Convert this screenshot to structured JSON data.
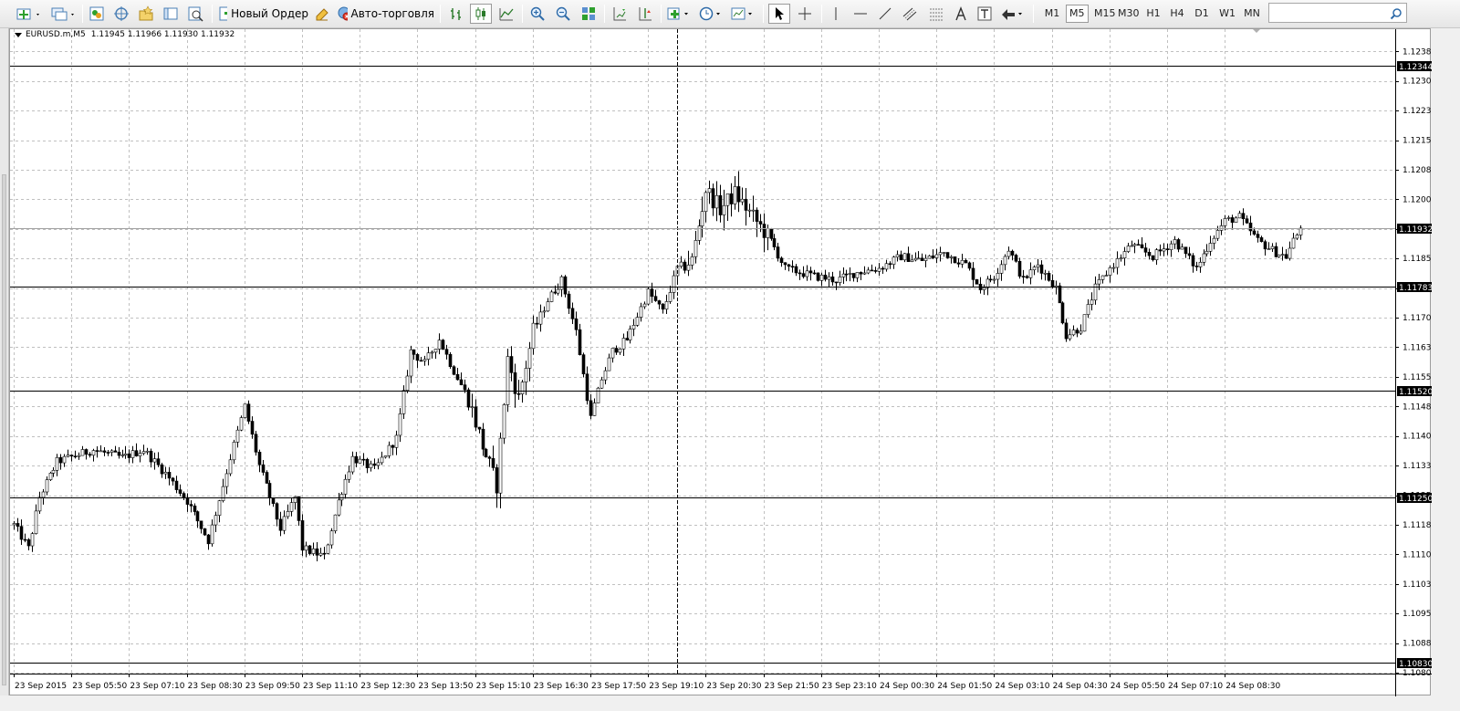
{
  "toolbar": {
    "new_order_label": "Новый Ордер",
    "autotrade_label": "Авто-торговля",
    "timeframes": [
      "M1",
      "M5",
      "M15",
      "M30",
      "H1",
      "H4",
      "D1",
      "W1",
      "MN"
    ],
    "active_timeframe": "M5",
    "search_value": "",
    "icons": [
      "new-chart-icon",
      "profiles-icon",
      "market-watch-icon",
      "navigator-icon",
      "data-window-icon",
      "terminal-icon",
      "strategy-tester-icon",
      "new-order-icon",
      "meta-editor-icon",
      "auto-trading-icon",
      "bar-chart-icon",
      "candlestick-icon",
      "line-chart-icon",
      "zoom-in-icon",
      "zoom-out-icon",
      "tile-windows-icon",
      "chart-shift-icon",
      "autoscroll-icon",
      "indicators-icon",
      "periods-icon",
      "templates-icon",
      "cursor-icon",
      "crosshair-icon",
      "vertical-line-icon",
      "horizontal-line-icon",
      "trendline-icon",
      "equidistant-channel-icon",
      "fibonacci-icon",
      "text-icon",
      "text-label-icon",
      "arrows-icon",
      "search-icon"
    ]
  },
  "chart": {
    "caption_symbol": "EURUSD.m,M5",
    "caption_ohlc": "1.11945 1.11966 1.11930 1.11932",
    "current_price": "1.11932",
    "current_price_value": 1.11932,
    "horizontal_lines": [
      {
        "value": 1.12344,
        "label": "1.12344"
      },
      {
        "value": 1.11783,
        "label": "1.11783"
      },
      {
        "value": 1.1152,
        "label": "1.11520"
      },
      {
        "value": 1.1125,
        "label": "1.11250"
      },
      {
        "value": 1.1083,
        "label": "1.10830"
      }
    ],
    "crosshair_time_index": 184,
    "colors": {
      "candle": "#000000",
      "grid": "#c0c0c0",
      "line": "#000000",
      "current_line": "#a0a0a0"
    }
  },
  "chart_data": {
    "type": "candlestick",
    "title": "EURUSD.m,M5",
    "ylim": [
      1.10805,
      1.1242
    ],
    "y_ticks": [
      "1.12380",
      "1.12305",
      "1.12230",
      "1.12155",
      "1.12080",
      "1.12005",
      "1.11930",
      "1.11855",
      "1.11780",
      "1.11705",
      "1.11630",
      "1.11555",
      "1.11480",
      "1.11405",
      "1.11330",
      "1.11255",
      "1.11180",
      "1.11105",
      "1.11030",
      "1.10955",
      "1.10880",
      "1.10805"
    ],
    "x_ticks": [
      "23 Sep 2015",
      "23 Sep 05:50",
      "23 Sep 07:10",
      "23 Sep 08:30",
      "23 Sep 09:50",
      "23 Sep 11:10",
      "23 Sep 12:30",
      "23 Sep 13:50",
      "23 Sep 15:10",
      "23 Sep 16:30",
      "23 Sep 17:50",
      "23 Sep 19:10",
      "23 Sep 20:30",
      "23 Sep 21:50",
      "23 Sep 23:10",
      "24 Sep 00:30",
      "24 Sep 01:50",
      "24 Sep 03:10",
      "24 Sep 04:30",
      "24 Sep 05:50",
      "24 Sep 07:10",
      "24 Sep 08:30"
    ],
    "x_tick_bar_index": [
      0,
      16,
      32,
      48,
      64,
      80,
      96,
      112,
      128,
      144,
      160,
      176,
      192,
      208,
      224,
      240,
      256,
      272,
      288,
      304,
      320,
      336
    ],
    "anchors": [
      [
        0,
        1.1118
      ],
      [
        4,
        1.1112
      ],
      [
        7,
        1.1125
      ],
      [
        12,
        1.1134
      ],
      [
        22,
        1.1137
      ],
      [
        30,
        1.1135
      ],
      [
        36,
        1.1137
      ],
      [
        42,
        1.1131
      ],
      [
        48,
        1.1124
      ],
      [
        54,
        1.1114
      ],
      [
        60,
        1.1135
      ],
      [
        64,
        1.1148
      ],
      [
        68,
        1.1133
      ],
      [
        74,
        1.1117
      ],
      [
        78,
        1.1125
      ],
      [
        80,
        1.1112
      ],
      [
        86,
        1.111
      ],
      [
        90,
        1.1124
      ],
      [
        94,
        1.1135
      ],
      [
        100,
        1.1132
      ],
      [
        106,
        1.114
      ],
      [
        110,
        1.1162
      ],
      [
        114,
        1.1159
      ],
      [
        118,
        1.1165
      ],
      [
        122,
        1.1157
      ],
      [
        126,
        1.115
      ],
      [
        130,
        1.1138
      ],
      [
        134,
        1.1128
      ],
      [
        137,
        1.116
      ],
      [
        140,
        1.115
      ],
      [
        144,
        1.1167
      ],
      [
        148,
        1.1175
      ],
      [
        152,
        1.118
      ],
      [
        156,
        1.1167
      ],
      [
        160,
        1.1145
      ],
      [
        163,
        1.1155
      ],
      [
        166,
        1.1162
      ],
      [
        170,
        1.1165
      ],
      [
        176,
        1.1177
      ],
      [
        180,
        1.1172
      ],
      [
        184,
        1.1183
      ],
      [
        188,
        1.1185
      ],
      [
        192,
        1.1203
      ],
      [
        196,
        1.1198
      ],
      [
        200,
        1.1202
      ],
      [
        205,
        1.1196
      ],
      [
        210,
        1.119
      ],
      [
        214,
        1.1183
      ],
      [
        218,
        1.1182
      ],
      [
        222,
        1.1181
      ],
      [
        228,
        1.118
      ],
      [
        234,
        1.1182
      ],
      [
        240,
        1.1183
      ],
      [
        246,
        1.1186
      ],
      [
        252,
        1.1185
      ],
      [
        258,
        1.1187
      ],
      [
        264,
        1.1184
      ],
      [
        268,
        1.1178
      ],
      [
        272,
        1.1181
      ],
      [
        276,
        1.1188
      ],
      [
        280,
        1.118
      ],
      [
        284,
        1.1184
      ],
      [
        289,
        1.1178
      ],
      [
        292,
        1.1166
      ],
      [
        296,
        1.1168
      ],
      [
        300,
        1.1178
      ],
      [
        304,
        1.1183
      ],
      [
        310,
        1.1189
      ],
      [
        316,
        1.1186
      ],
      [
        322,
        1.119
      ],
      [
        328,
        1.1183
      ],
      [
        332,
        1.119
      ],
      [
        336,
        1.1195
      ],
      [
        340,
        1.1196
      ],
      [
        345,
        1.119
      ],
      [
        350,
        1.1187
      ],
      [
        353,
        1.1186
      ],
      [
        355,
        1.119
      ],
      [
        357,
        1.1193
      ]
    ],
    "bar_count": 358
  }
}
